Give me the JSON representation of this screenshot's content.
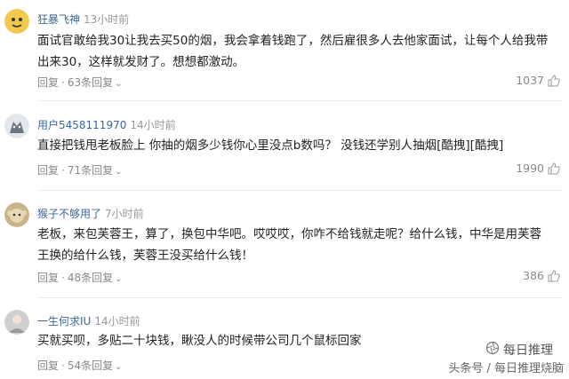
{
  "comments": [
    {
      "username": "狂暴飞神",
      "time": "13小时前",
      "text": "面试官敢给我30让我去买50的烟，我会拿着钱跑了，然后雇很多人去他家面试，让每个人给我带出来30，这样就发财了。想想都激动。",
      "reply_label": "回复",
      "replies_label": "63条回复",
      "likes": "1037"
    },
    {
      "username": "用户5458111970",
      "time": "14小时前",
      "text": "直接把钱甩老板脸上 你抽的烟多少钱你心里没点b数吗？ 没钱还学别人抽烟[酷拽][酷拽]",
      "reply_label": "回复",
      "replies_label": "71条回复",
      "likes": "1990"
    },
    {
      "username": "猴子不够用了",
      "time": "7小时前",
      "text": "老板，来包芙蓉王，算了，换包中华吧。哎哎哎，你咋不给钱就走呢？给什么钱，中华是用芙蓉王换的给什么钱，芙蓉王没买给什么钱！",
      "reply_label": "回复",
      "replies_label": "48条回复",
      "likes": "386"
    },
    {
      "username": "一生何求IU",
      "time": "14小时前",
      "text": "买就买呗，多贴二十块钱，瞅没人的时候带公司几个鼠标回家",
      "reply_label": "回复",
      "replies_label": "54条回复",
      "likes": ""
    }
  ],
  "watermark": {
    "brand": "每日推理",
    "source": "头条号 / 每日推理烧脑"
  },
  "icons": {
    "like": "thumbs-up-icon",
    "expand": "chevron-down-icon",
    "watermark": "camera-shutter-icon"
  },
  "colors": {
    "username": "#406599",
    "meta": "#888888",
    "text": "#222222"
  }
}
